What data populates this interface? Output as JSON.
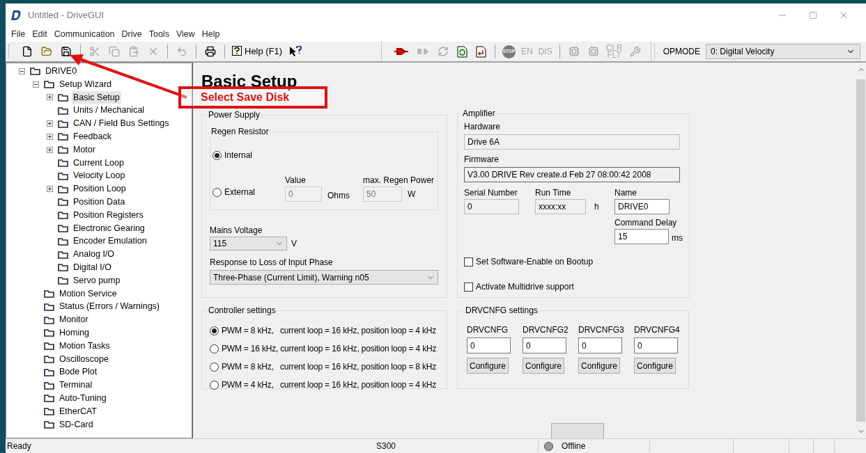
{
  "window": {
    "title": "Untitled - DriveGUI"
  },
  "menu": [
    "File",
    "Edit",
    "Communication",
    "Drive",
    "Tools",
    "View",
    "Help"
  ],
  "toolbar": [
    {
      "kind": "icon",
      "disabled": false
    },
    {
      "kind": "icon",
      "disabled": false
    },
    {
      "kind": "icon",
      "disabled": false
    },
    {
      "kind": "separator"
    },
    {
      "kind": "icon",
      "disabled": true
    },
    {
      "kind": "icon",
      "disabled": true
    },
    {
      "kind": "icon",
      "disabled": true
    },
    {
      "kind": "icon",
      "disabled": true
    },
    {
      "kind": "separator"
    },
    {
      "kind": "icon",
      "disabled": true
    },
    {
      "kind": "separator"
    },
    {
      "kind": "icon",
      "disabled": false
    },
    {
      "kind": "separator"
    },
    {
      "kind": "labeled",
      "label": "Help (F1)",
      "disabled": false
    },
    {
      "kind": "icon",
      "disabled": false
    }
  ],
  "toolbar2": [
    {
      "kind": "icon",
      "disabled": false
    },
    {
      "kind": "icon",
      "disabled": true
    },
    {
      "kind": "icon",
      "disabled": true
    },
    {
      "kind": "icon",
      "disabled": false
    },
    {
      "kind": "icon",
      "disabled": false
    },
    {
      "kind": "separator"
    },
    {
      "kind": "stop",
      "label": "STOP",
      "disabled": true
    },
    {
      "kind": "text",
      "label": "EN",
      "disabled": true
    },
    {
      "kind": "text",
      "label": "DIS",
      "disabled": true
    },
    {
      "kind": "separator"
    },
    {
      "kind": "icon",
      "disabled": true
    },
    {
      "kind": "icon",
      "disabled": true
    },
    {
      "kind": "text",
      "label": "CLR FLT",
      "disabled": true
    },
    {
      "kind": "icon",
      "disabled": true
    }
  ],
  "opmode": {
    "label": "OPMODE",
    "value": "0: Digital Velocity"
  },
  "tree": [
    {
      "label": "DRIVE0",
      "expanded": true,
      "selected": false,
      "children": [
        {
          "label": "Setup Wizard",
          "expanded": true,
          "selected": false,
          "children": [
            {
              "label": "Basic Setup",
              "expanded": false,
              "selected": true
            },
            {
              "label": "Units / Mechanical",
              "selected": false
            },
            {
              "label": "CAN / Field Bus Settings",
              "expanded": false,
              "selected": false
            },
            {
              "label": "Feedback",
              "expanded": false,
              "selected": false
            },
            {
              "label": "Motor",
              "expanded": false,
              "selected": false
            },
            {
              "label": "Current Loop",
              "selected": false
            },
            {
              "label": "Velocity Loop",
              "selected": false
            },
            {
              "label": "Position Loop",
              "expanded": false,
              "selected": false
            },
            {
              "label": "Position Data",
              "selected": false
            },
            {
              "label": "Position Registers",
              "selected": false
            },
            {
              "label": "Electronic Gearing",
              "selected": false
            },
            {
              "label": "Encoder Emulation",
              "selected": false
            },
            {
              "label": "Analog I/O",
              "selected": false
            },
            {
              "label": "Digital I/O",
              "selected": false
            },
            {
              "label": "Servo pump",
              "selected": false
            }
          ]
        },
        {
          "label": "Motion Service",
          "selected": false
        },
        {
          "label": "Status (Errors / Warnings)",
          "selected": false
        },
        {
          "label": "Monitor",
          "selected": false
        },
        {
          "label": "Homing",
          "selected": false
        },
        {
          "label": "Motion Tasks",
          "selected": false
        },
        {
          "label": "Oscilloscope",
          "selected": false
        },
        {
          "label": "Bode Plot",
          "selected": false
        },
        {
          "label": "Terminal",
          "selected": false
        },
        {
          "label": "Auto-Tuning",
          "selected": false
        },
        {
          "label": "EtherCAT",
          "selected": false
        },
        {
          "label": "SD-Card",
          "selected": false
        }
      ]
    }
  ],
  "page": {
    "title": "Basic Setup",
    "power_supply": {
      "title": "Power Supply",
      "regen": {
        "title": "Regen Resistor",
        "options": [
          {
            "label": "Internal",
            "selected": true
          },
          {
            "label": "External",
            "selected": false
          }
        ],
        "value_label": "Value",
        "value": "0",
        "value_unit": "Ohms",
        "power_label": "max. Regen Power",
        "power": "50",
        "power_unit": "W"
      },
      "mains_label": "Mains Voltage",
      "mains": "115",
      "mains_unit": "V",
      "loss_label": "Response to Loss of Input Phase",
      "loss": "Three-Phase (Current Limit), Warning n05"
    },
    "amplifier": {
      "title": "Amplifier",
      "hardware_label": "Hardware",
      "hardware": "Drive 6A",
      "firmware_label": "Firmware",
      "firmware": "V3.00 DRIVE Rev create.d Feb 27 08:00:42 2008",
      "serial_label": "Serial Number",
      "serial": "0",
      "runtime_label": "Run Time",
      "runtime": "xxxx:xx",
      "runtime_unit": "h",
      "name_label": "Name",
      "name": "DRIVE0",
      "delay_label": "Command Delay",
      "delay": "15",
      "delay_unit": "ms",
      "checks": [
        {
          "label": "Set Software-Enable on Bootup",
          "checked": false
        },
        {
          "label": "Activate Multidrive support",
          "checked": false
        }
      ]
    },
    "controller": {
      "title": "Controller settings",
      "options": [
        {
          "label": "PWM = 8 kHz,   current loop = 16 kHz, position loop = 4 kHz",
          "selected": true
        },
        {
          "label": "PWM = 16 kHz, current loop = 16 kHz, position loop = 4 kHz",
          "selected": false
        },
        {
          "label": "PWM = 8 kHz,   current loop = 16 kHz, position loop = 8 kHz",
          "selected": false
        },
        {
          "label": "PWM = 4 kHz,   current loop = 16 kHz, position loop = 4 kHz",
          "selected": false
        }
      ]
    },
    "drvcnfg": {
      "title": "DRVCNFG settings",
      "items": [
        {
          "label": "DRVCNFG",
          "value": "0",
          "button": "Configure"
        },
        {
          "label": "DRVCNFG2",
          "value": "0",
          "button": "Configure"
        },
        {
          "label": "DRVCNFG3",
          "value": "0",
          "button": "Configure"
        },
        {
          "label": "DRVCNFG4",
          "value": "0",
          "button": "Configure"
        }
      ]
    }
  },
  "annotation": {
    "text": "Select Save Disk"
  },
  "status_bar": {
    "message": "Ready",
    "device": "S300",
    "connection": "Offline",
    "online": false
  }
}
